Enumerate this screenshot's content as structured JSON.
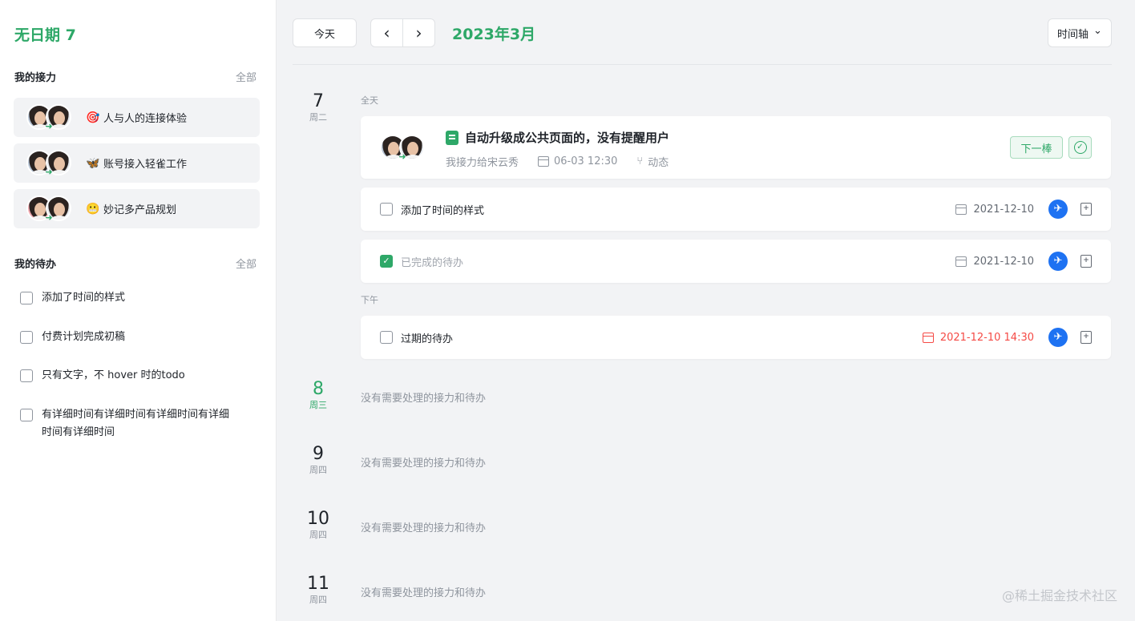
{
  "sidebar": {
    "title": "无日期 7",
    "relay_section": {
      "title": "我的接力",
      "all": "全部"
    },
    "relays": [
      {
        "emoji": "🎯",
        "label": "人与人的连接体验"
      },
      {
        "emoji": "🦋",
        "label": "账号接入轻雀工作"
      },
      {
        "emoji": "😬",
        "label": "妙记多产品规划"
      }
    ],
    "todo_section": {
      "title": "我的待办",
      "all": "全部"
    },
    "todos": [
      {
        "label": "添加了时间的样式"
      },
      {
        "label": "付费计划完成初稿"
      },
      {
        "label": "只有文字，不 hover 时的todo"
      },
      {
        "label": "有详细时间有详细时间有详细时间有详细时间有详细时间"
      }
    ]
  },
  "toolbar": {
    "today": "今天",
    "prev": "‹",
    "next": "›",
    "month": "2023年3月",
    "view": "时间轴",
    "view_chevron": "⌄"
  },
  "days": [
    {
      "num": "7",
      "week": "周二"
    },
    {
      "num": "8",
      "week": "周三"
    },
    {
      "num": "9",
      "week": "周四"
    },
    {
      "num": "10",
      "week": "周四"
    },
    {
      "num": "11",
      "week": "周四"
    }
  ],
  "allday_label": "全天",
  "afternoon_label": "下午",
  "empty_text": "没有需要处理的接力和待办",
  "relay_card": {
    "title": "自动升级成公共页面的，没有提醒用户",
    "from": "我接力给宋云秀",
    "time": "06-03 12:30",
    "activity": "动态",
    "next_btn": "下一棒",
    "done_icon": "✓"
  },
  "tasks": [
    {
      "label": "添加了时间的样式",
      "date": "2021-12-10",
      "checked": false
    },
    {
      "label": "已完成的待办",
      "date": "2021-12-10",
      "checked": true
    },
    {
      "label": "过期的待办",
      "date": "2021-12-10 14:30",
      "checked": false,
      "overdue": true
    }
  ],
  "icons": {
    "lark": "✈",
    "file": "+",
    "check": "✓",
    "tree": "⑂",
    "arrow": "➜"
  },
  "colors": {
    "accent": "#2ea868",
    "overdue": "#f54a45",
    "lark": "#1e72f2"
  },
  "watermark": "@稀土掘金技术社区"
}
